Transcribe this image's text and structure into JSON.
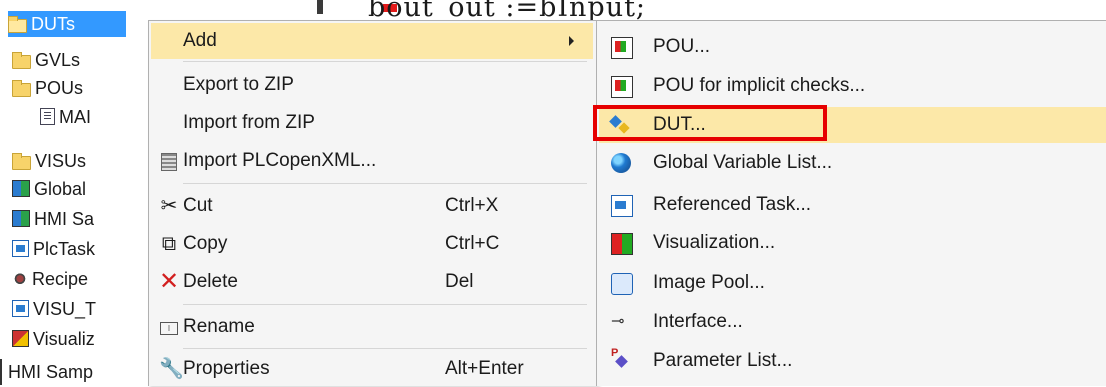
{
  "tree": {
    "items": [
      {
        "label": "DUTs",
        "icon": "folder-icon",
        "selected": true
      },
      {
        "label": "GVLs",
        "icon": "folder-icon"
      },
      {
        "label": "POUs",
        "icon": "folder-open-icon"
      },
      {
        "label": "MAI",
        "icon": "program-icon"
      },
      {
        "label": "VISUs",
        "icon": "folder-icon"
      },
      {
        "label": "Global",
        "icon": "global-vars-icon"
      },
      {
        "label": "HMI Sa",
        "icon": "hmi-icon"
      },
      {
        "label": "PlcTask",
        "icon": "task-icon"
      },
      {
        "label": "Recipe",
        "icon": "recipe-icon"
      },
      {
        "label": "VISU_T",
        "icon": "task-icon"
      },
      {
        "label": "Visualiz",
        "icon": "visualization-icon"
      },
      {
        "label": "HMI Samp",
        "icon": "none"
      }
    ]
  },
  "editor": {
    "code_fragment": "bout_out :=bInput;"
  },
  "context_menu": {
    "items": [
      {
        "label": "Add",
        "shortcut": "",
        "icon": "none",
        "has_submenu": true,
        "hover": true
      },
      {
        "label": "Export to ZIP",
        "shortcut": "",
        "icon": "none"
      },
      {
        "label": "Import from ZIP",
        "shortcut": "",
        "icon": "none"
      },
      {
        "label": "Import PLCopenXML...",
        "shortcut": "",
        "icon": "import-xml-icon"
      },
      {
        "label": "Cut",
        "shortcut": "Ctrl+X",
        "icon": "scissors-icon"
      },
      {
        "label": "Copy",
        "shortcut": "Ctrl+C",
        "icon": "copy-icon"
      },
      {
        "label": "Delete",
        "shortcut": "Del",
        "icon": "delete-x-icon"
      },
      {
        "label": "Rename",
        "shortcut": "",
        "icon": "rename-icon"
      },
      {
        "label": "Properties",
        "shortcut": "Alt+Enter",
        "icon": "wrench-icon"
      }
    ]
  },
  "submenu": {
    "items": [
      {
        "label": "POU...",
        "icon": "pou-icon"
      },
      {
        "label": "POU for implicit checks...",
        "icon": "pou-icon"
      },
      {
        "label": "DUT...",
        "icon": "dut-icon",
        "hover": true,
        "highlighted": true
      },
      {
        "label": "Global Variable List...",
        "icon": "globe-icon"
      },
      {
        "label": "Referenced Task...",
        "icon": "referenced-task-icon"
      },
      {
        "label": "Visualization...",
        "icon": "visualization-icon"
      },
      {
        "label": "Image Pool...",
        "icon": "image-pool-icon"
      },
      {
        "label": "Interface...",
        "icon": "interface-icon"
      },
      {
        "label": "Parameter List...",
        "icon": "parameter-list-icon"
      }
    ]
  },
  "colors": {
    "selection": "#3399ff",
    "menu_hover": "#fce8a8",
    "highlight_box": "#e60000",
    "delete_icon": "#d21f1f"
  }
}
